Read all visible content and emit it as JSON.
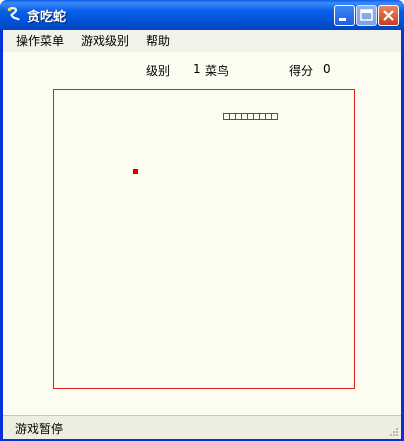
{
  "window": {
    "title": "贪吃蛇",
    "buttons": [
      "minimize-button",
      "maximize-button",
      "close-button"
    ]
  },
  "menu": {
    "items": [
      "操作菜单",
      "游戏级别",
      "帮助"
    ]
  },
  "info": {
    "level_label": "级别",
    "level_value": "1",
    "level_name": "菜鸟",
    "score_label": "得分",
    "score_value": "0"
  },
  "game": {
    "snake_length": 9,
    "snake_color": "#1f7a1f",
    "food_color": "#d40000",
    "border_color": "#e02020"
  },
  "status": {
    "text": "游戏暂停"
  },
  "colors": {
    "window_bg": "#fcfcf0",
    "title_blue": "#0a60ea"
  }
}
